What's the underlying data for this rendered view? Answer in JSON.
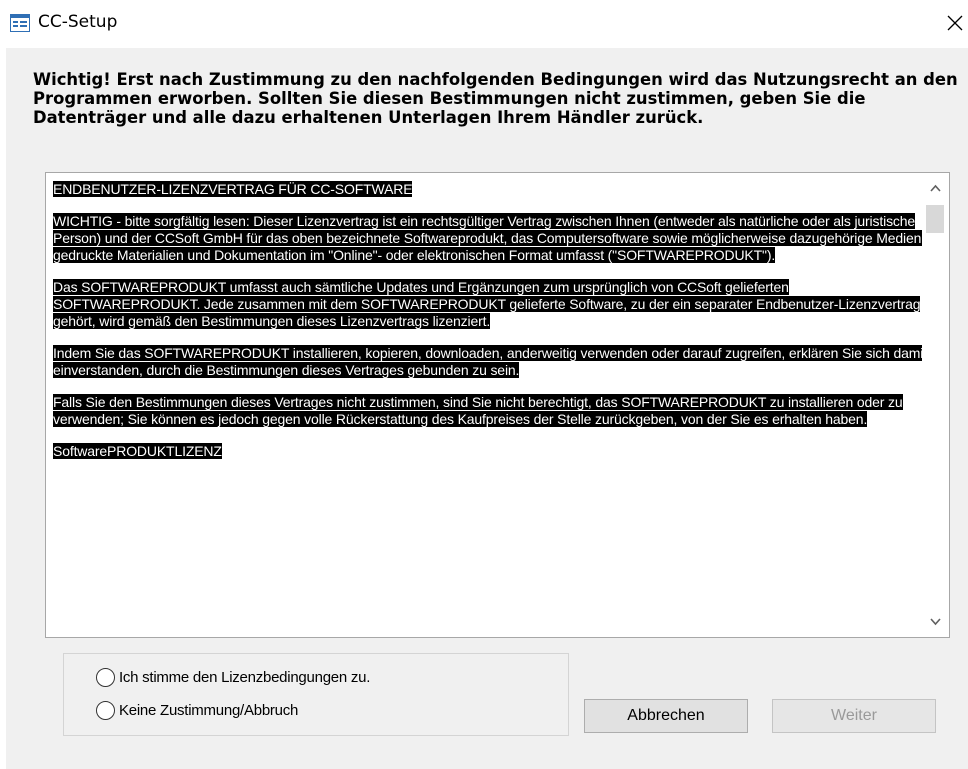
{
  "window": {
    "title": "CC-Setup",
    "icon": "form-window-icon",
    "close_icon": "close-icon"
  },
  "header": {
    "notice": "Wichtig! Erst nach Zustimmung zu den nachfolgenden Bedingungen wird das Nutzungsrecht an den Programmen erworben. Sollten Sie diesen Bestimmungen nicht zustimmen, geben Sie die Datenträger und alle dazu erhaltenen Unterlagen Ihrem Händler zurück."
  },
  "eula": {
    "paragraphs": [
      "ENDBENUTZER-LIZENZVERTRAG FÜR CC-SOFTWARE",
      "WICHTIG - bitte sorgfältig lesen: Dieser Lizenzvertrag  ist ein rechtsgültiger Vertrag zwischen Ihnen (entweder als natürliche oder als juristische Person) und der CCSoft GmbH für das oben bezeichnete Softwareprodukt, das Computersoftware sowie möglicherweise dazugehörige Medien, gedruckte Materialien und Dokumentation im \"Online\"- oder elektronischen Format umfasst (\"SOFTWAREPRODUKT\").",
      "Das SOFTWAREPRODUKT umfasst auch sämtliche Updates und Ergänzungen zum ursprünglich von CCSoft gelieferten SOFTWAREPRODUKT. Jede zusammen mit dem SOFTWAREPRODUKT gelieferte Software, zu der ein separater Endbenutzer-Lizenzvertrag gehört, wird gemäß den Bestimmungen dieses Lizenzvertrags lizenziert.",
      "Indem Sie das SOFTWAREPRODUKT installieren, kopieren, downloaden, anderweitig verwenden oder darauf zugreifen, erklären Sie sich damit einverstanden, durch die Bestimmungen dieses Vertrages gebunden zu sein.",
      "Falls Sie den Bestimmungen dieses Vertrages nicht zustimmen, sind Sie nicht berechtigt, das SOFTWAREPRODUKT zu installieren oder zu verwenden; Sie können es jedoch gegen volle Rückerstattung des Kaufpreises der Stelle zurückgeben, von der Sie es erhalten haben.",
      "SoftwarePRODUKTLIZENZ"
    ],
    "selection_highlight": "#000000",
    "scrollbar": {
      "up_icon": "chevron-up-icon",
      "down_icon": "chevron-down-icon"
    }
  },
  "options": [
    {
      "label": "Ich stimme den Lizenzbedingungen zu.",
      "selected": false
    },
    {
      "label": "Keine Zustimmung/Abbruch",
      "selected": false
    }
  ],
  "buttons": {
    "cancel": {
      "label": "Abbrechen",
      "enabled": true
    },
    "next": {
      "label": "Weiter",
      "enabled": false
    }
  }
}
